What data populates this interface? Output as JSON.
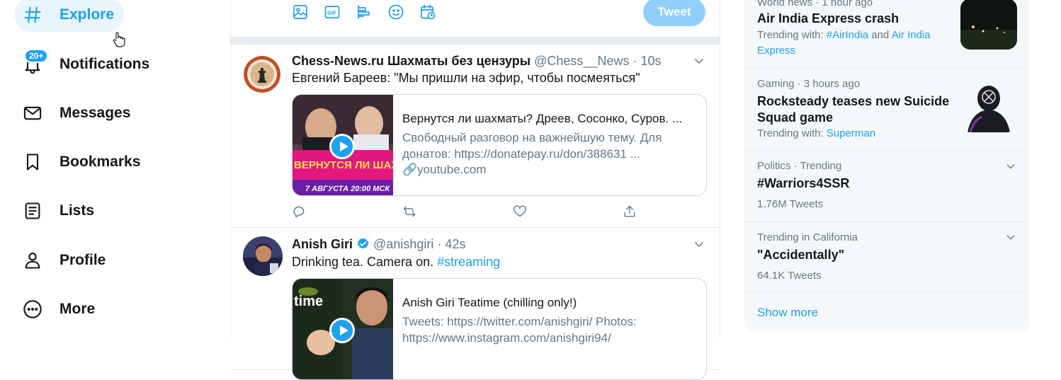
{
  "nav": {
    "explore": "Explore",
    "notifications": "Notifications",
    "notifications_badge": "20+",
    "messages": "Messages",
    "bookmarks": "Bookmarks",
    "lists": "Lists",
    "profile": "Profile",
    "more": "More"
  },
  "compose": {
    "tweet_button": "Tweet",
    "icons": [
      "image-icon",
      "gif-icon",
      "poll-icon",
      "emoji-icon",
      "schedule-icon"
    ]
  },
  "tweets": [
    {
      "name": "Chess-News.ru Шахматы без цензуры",
      "handle": "@Chess__News",
      "time": "10s",
      "text": "Евгений Бареев: \"Мы пришли на эфир, чтобы посмеяться\"",
      "card": {
        "title": "Вернутся ли шахматы? Дреев, Сосонко, Суров. ...",
        "description": "Свободный разговор на важнейшую тему. Для донатов: https://donatepay.ru/don/388631 ...",
        "link": "youtube.com",
        "thumb_text": "ВЕРНУТСЯ ЛИ ШАХМАТЫ?",
        "thumb_date": "7 АВГУСТА 20:00 МСК"
      }
    },
    {
      "name": "Anish Giri",
      "handle": "@anishgiri",
      "time": "42s",
      "text": "Drinking tea. Camera on.",
      "hashtag": "#streaming",
      "card": {
        "title": "Anish Giri Teatime (chilling only!)",
        "description": "Tweets: https://twitter.com/anishgiri/ Photos: https://www.instagram.com/anishgiri94/",
        "thumb_text": "time"
      }
    }
  ],
  "trends": [
    {
      "context": "World news · 1 hour ago",
      "title": "Air India Express crash",
      "sub_prefix": "Trending with: ",
      "link1": "#AirIndia",
      "and": " and ",
      "link2": "Air India Express"
    },
    {
      "context": "Gaming · 3 hours ago",
      "title": "Rocksteady teases new Suicide Squad game",
      "sub_prefix": "Trending with: ",
      "link1": "Superman"
    },
    {
      "context": "Politics · Trending",
      "title": "#Warriors4SSR",
      "count": "1.76M Tweets"
    },
    {
      "context": "Trending in California",
      "title": "\"Accidentally\"",
      "count": "64.1K Tweets"
    }
  ],
  "show_more": "Show more",
  "colors": {
    "accent": "#1da1f2",
    "text": "#14171a",
    "muted": "#657786"
  }
}
